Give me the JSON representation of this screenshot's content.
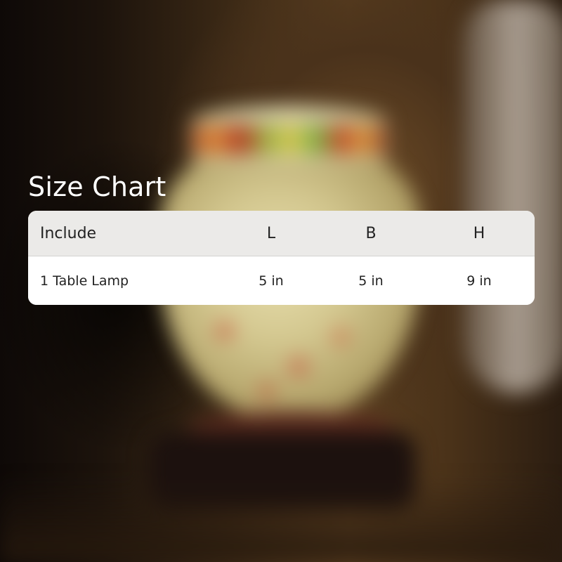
{
  "title": "Size Chart",
  "table": {
    "headers": [
      "Include",
      "L",
      "B",
      "H"
    ],
    "rows": [
      [
        "1 Table Lamp",
        "5 in",
        "5 in",
        "9 in"
      ]
    ]
  }
}
